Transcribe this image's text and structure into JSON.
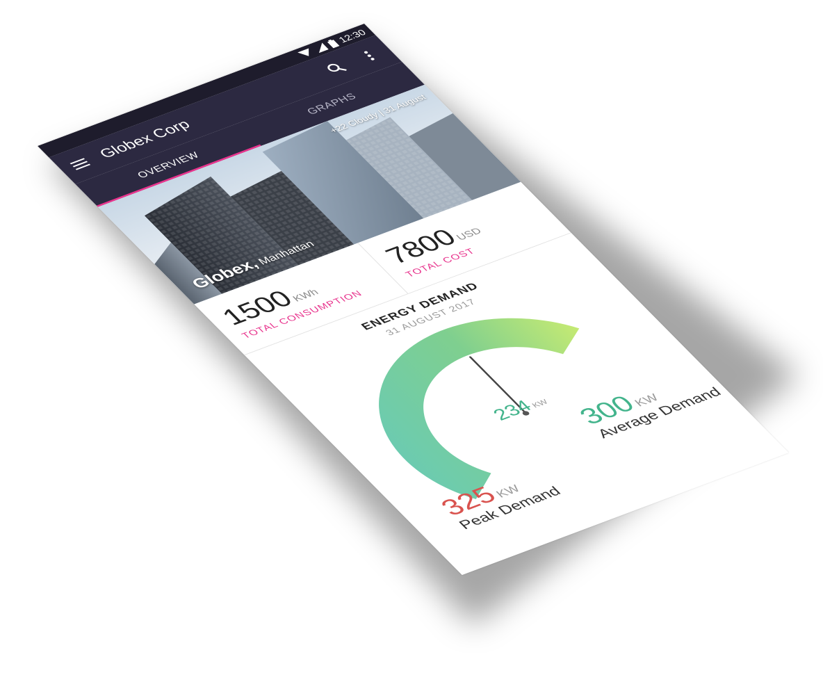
{
  "status_bar": {
    "time": "12:30"
  },
  "app_bar": {
    "title": "Globex Corp"
  },
  "tabs": [
    {
      "label": "OVERVIEW",
      "active": true
    },
    {
      "label": "GRAPHS",
      "active": false
    }
  ],
  "hero": {
    "weather": "+22 Cloudy  |  31 August",
    "place_name": "Globex,",
    "place_area": "Manhattan"
  },
  "stats": {
    "consumption": {
      "value": "1500",
      "unit": "KWh",
      "label": "TOTAL CONSUMPTION"
    },
    "cost": {
      "value": "7800",
      "unit": "USD",
      "label": "TOTAL COST"
    }
  },
  "energy_demand": {
    "title": "ENERGY DEMAND",
    "date": "31 AUGUST 2017",
    "current": {
      "value": "234",
      "unit": "KW"
    },
    "average": {
      "value": "300",
      "unit": "KW",
      "label": "Average Demand"
    },
    "peak": {
      "value": "325",
      "unit": "KW",
      "label": "Peak Demand"
    },
    "gauge_fraction": 0.72,
    "needle_fraction": 0.5,
    "colors": {
      "start": "#6ccbb0",
      "mid": "#7fcf8f",
      "end": "#c5ea73",
      "peak": "#d9534f",
      "accent": "#e8348d"
    }
  }
}
